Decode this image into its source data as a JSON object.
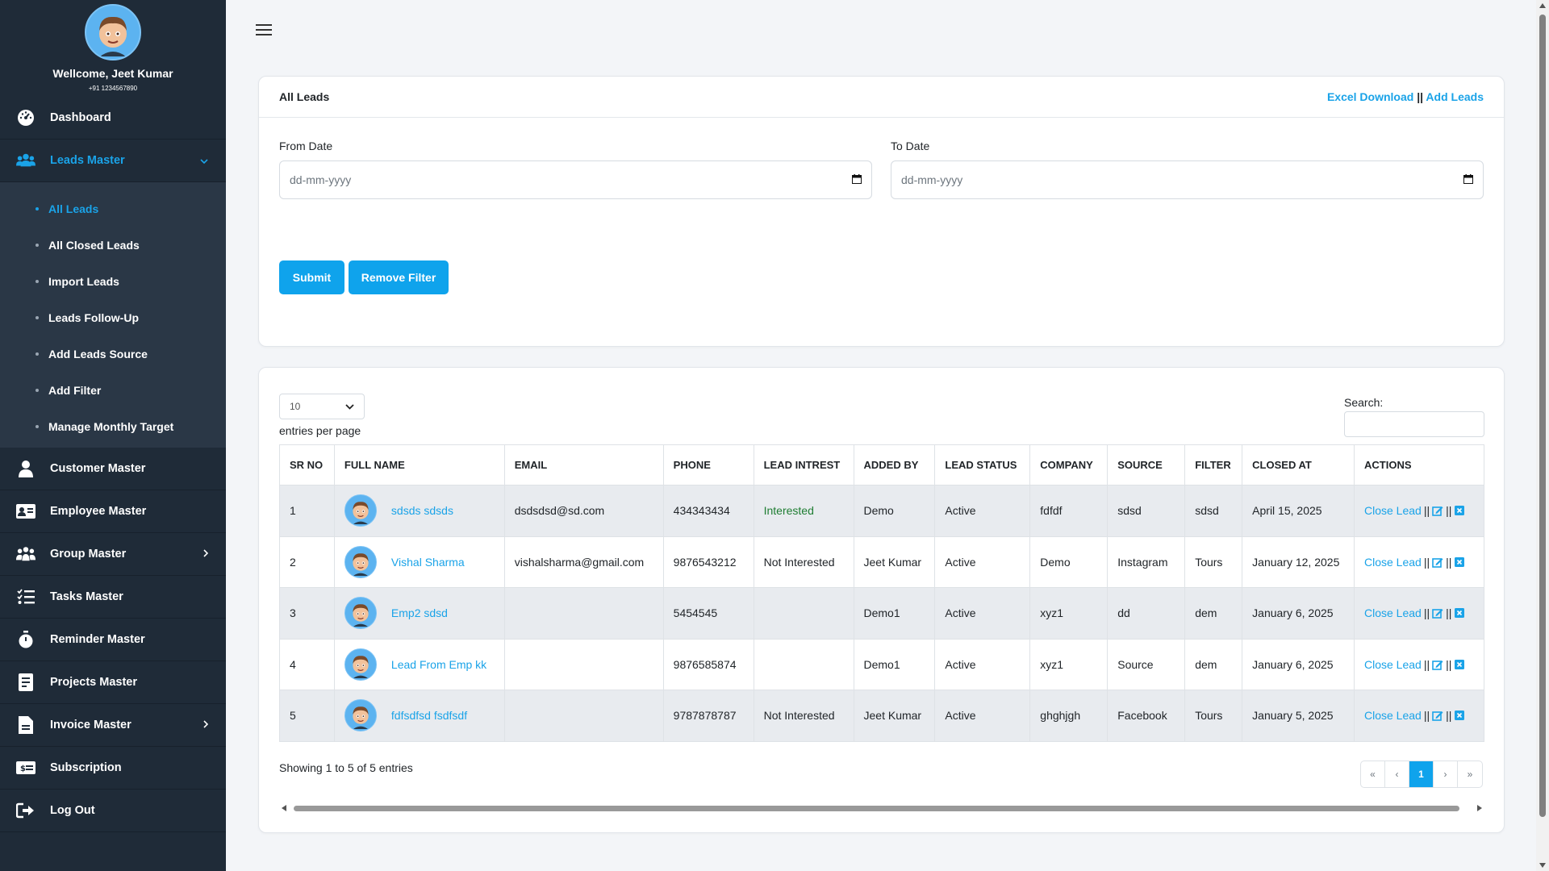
{
  "sidebar": {
    "welcome": "Wellcome, Jeet Kumar",
    "phone": "+91 1234567890",
    "items": [
      {
        "label": "Dashboard",
        "icon": "dashboard-icon"
      },
      {
        "label": "Leads Master",
        "icon": "users-icon"
      },
      {
        "label": "Customer Master",
        "icon": "user-icon"
      },
      {
        "label": "Employee Master",
        "icon": "id-card-icon"
      },
      {
        "label": "Group Master",
        "icon": "group-icon"
      },
      {
        "label": "Tasks Master",
        "icon": "tasks-icon"
      },
      {
        "label": "Reminder Master",
        "icon": "stopwatch-icon"
      },
      {
        "label": "Projects Master",
        "icon": "project-icon"
      },
      {
        "label": "Invoice Master",
        "icon": "invoice-icon"
      },
      {
        "label": "Subscription",
        "icon": "money-icon"
      },
      {
        "label": "Log Out",
        "icon": "logout-icon"
      }
    ],
    "sub_items": [
      {
        "label": "All Leads"
      },
      {
        "label": "All Closed Leads"
      },
      {
        "label": "Import Leads"
      },
      {
        "label": "Leads Follow-Up"
      },
      {
        "label": "Add Leads Source"
      },
      {
        "label": "Add Filter"
      },
      {
        "label": "Manage Monthly Target"
      }
    ]
  },
  "filter_card": {
    "title": "All Leads",
    "excel_link": "Excel Download",
    "separator": "||",
    "add_link": "Add Leads",
    "from_label": "From Date",
    "to_label": "To Date",
    "from_placeholder": "dd-mm-yyyy",
    "to_placeholder": "dd-mm-yyyy",
    "submit": "Submit",
    "remove_filter": "Remove Filter"
  },
  "table_card": {
    "entries_value": "10",
    "entries_label": "entries per page",
    "search_label": "Search:",
    "headers": [
      "SR NO",
      "FULL NAME",
      "EMAIL",
      "PHONE",
      "LEAD INTREST",
      "ADDED BY",
      "LEAD STATUS",
      "COMPANY",
      "SOURCE",
      "FILTER",
      "CLOSED AT",
      "ACTIONS"
    ],
    "rows": [
      {
        "sr": "1",
        "name": "sdsds sdsds",
        "email": "dsdsdsd@sd.com",
        "phone": "434343434",
        "interest": "Interested",
        "added_by": "Demo",
        "status": "Active",
        "company": "fdfdf",
        "source": "sdsd",
        "filter": "sdsd",
        "closed_at": "April 15, 2025"
      },
      {
        "sr": "2",
        "name": "Vishal Sharma",
        "email": "vishalsharma@gmail.com",
        "phone": "9876543212",
        "interest": "Not Interested",
        "added_by": "Jeet Kumar",
        "status": "Active",
        "company": "Demo",
        "source": "Instagram",
        "filter": "Tours",
        "closed_at": "January 12, 2025"
      },
      {
        "sr": "3",
        "name": "Emp2 sdsd",
        "email": "",
        "phone": "5454545",
        "interest": "",
        "added_by": "Demo1",
        "status": "Active",
        "company": "xyz1",
        "source": "dd",
        "filter": "dem",
        "closed_at": "January 6, 2025"
      },
      {
        "sr": "4",
        "name": "Lead From Emp kk",
        "email": "",
        "phone": "9876585874",
        "interest": "",
        "added_by": "Demo1",
        "status": "Active",
        "company": "xyz1",
        "source": "Source",
        "filter": "dem",
        "closed_at": "January 6, 2025"
      },
      {
        "sr": "5",
        "name": "fdfsdfsd fsdfsdf",
        "email": "",
        "phone": "9787878787",
        "interest": "Not Interested",
        "added_by": "Jeet Kumar",
        "status": "Active",
        "company": "ghghjgh",
        "source": "Facebook",
        "filter": "Tours",
        "closed_at": "January 5, 2025"
      }
    ],
    "close_lead": "Close Lead",
    "action_sep": "||",
    "showing": "Showing 1 to 5 of 5 entries",
    "pager": [
      "«",
      "‹",
      "1",
      "›",
      "»"
    ]
  },
  "colors": {
    "accent": "#1aa3e8",
    "sidebar_bg": "#1f2b38",
    "button": "#0fa3ec",
    "interested": "#1e7d32"
  }
}
